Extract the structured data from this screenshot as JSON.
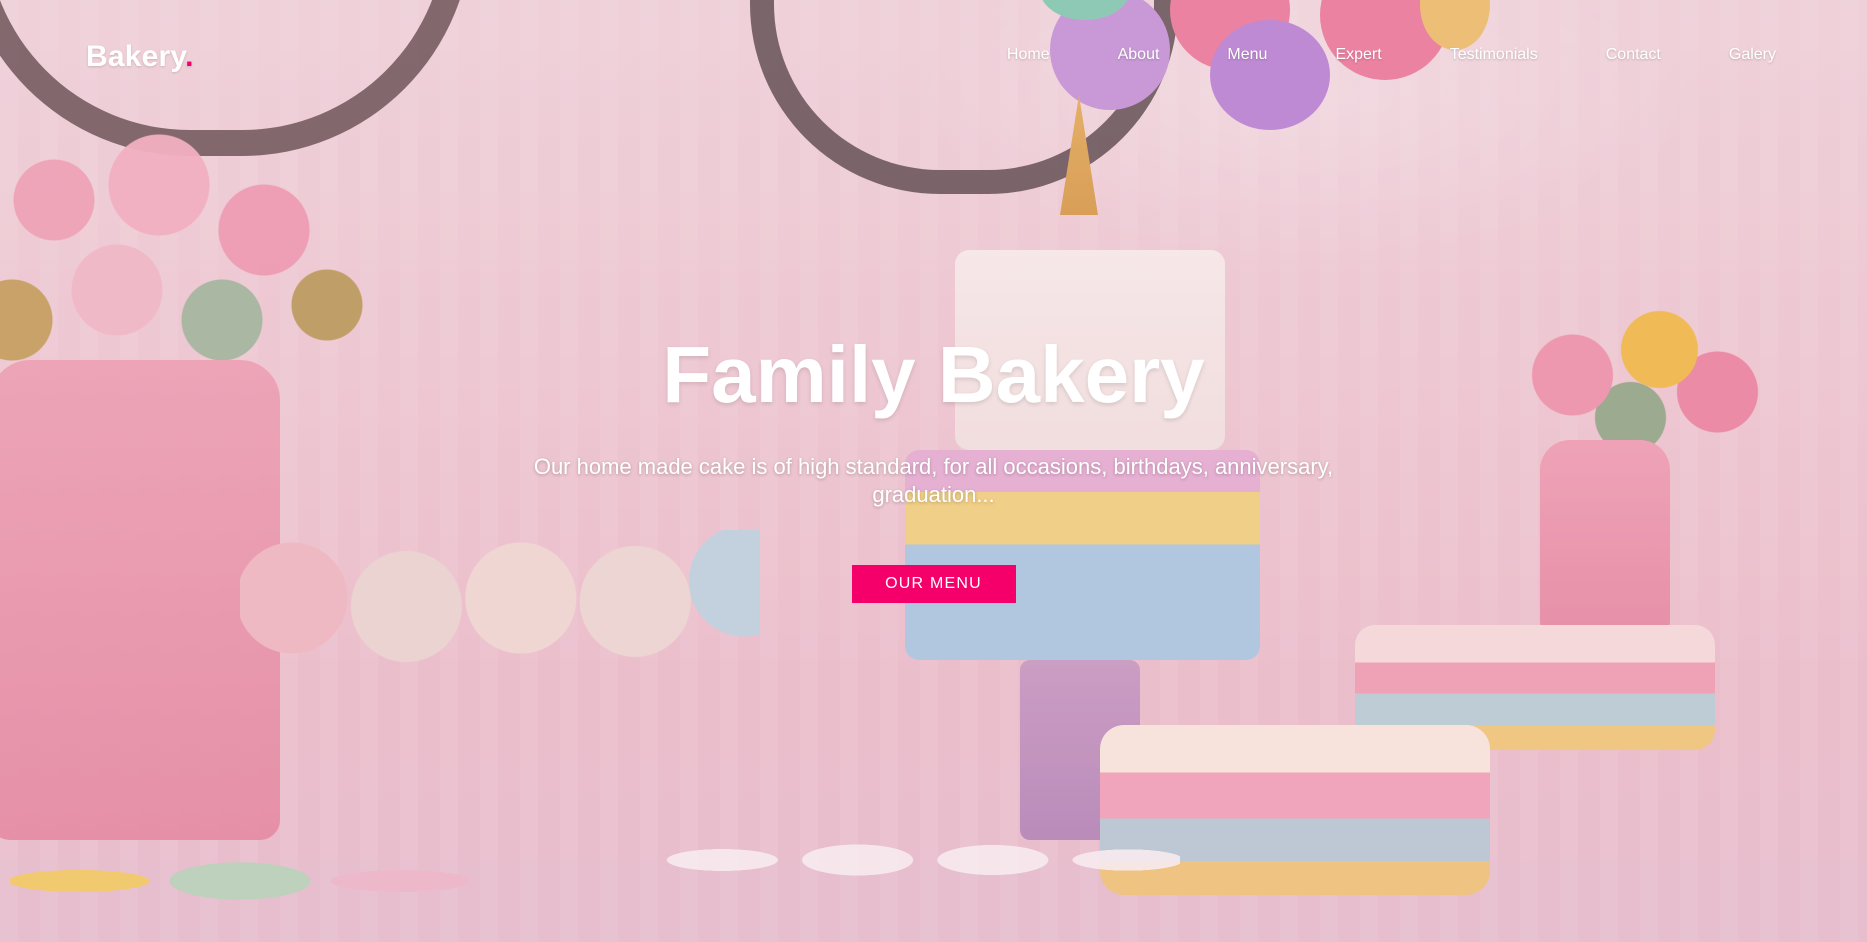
{
  "brand": {
    "name": "Bakery",
    "dot": ".",
    "accent_color": "#f5006b"
  },
  "nav": {
    "items": [
      {
        "label": "Home"
      },
      {
        "label": "About"
      },
      {
        "label": "Menu"
      },
      {
        "label": "Expert"
      },
      {
        "label": "Testimonials"
      },
      {
        "label": "Contact"
      },
      {
        "label": "Galery"
      }
    ]
  },
  "hero": {
    "title": "Family Bakery",
    "subtitle": "Our home made cake is of high standard, for all occasions, birthdays, anniversary, graduation...",
    "cta_label": "OUR MENU",
    "cta_color": "#f5006b"
  }
}
